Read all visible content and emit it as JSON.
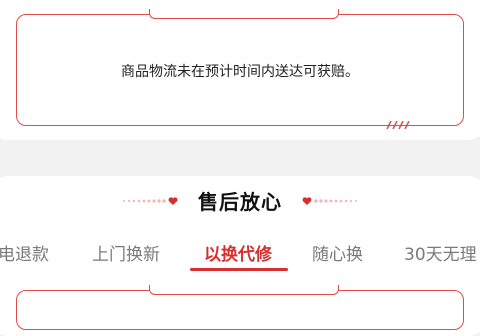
{
  "top_card": {
    "note": "商品物流未在预计时间内送达可获赔。"
  },
  "section": {
    "title": "售后放心"
  },
  "tabs": [
    {
      "label": "电退款",
      "active": false
    },
    {
      "label": "上门换新",
      "active": false
    },
    {
      "label": "以换代修",
      "active": true
    },
    {
      "label": "随心换",
      "active": false
    },
    {
      "label": "30天无理",
      "active": false
    }
  ],
  "colors": {
    "accent": "#d62f2f",
    "frame": "#e04b4b",
    "background": "#f2f2f2"
  },
  "icons": {
    "heart": "heart-icon"
  }
}
